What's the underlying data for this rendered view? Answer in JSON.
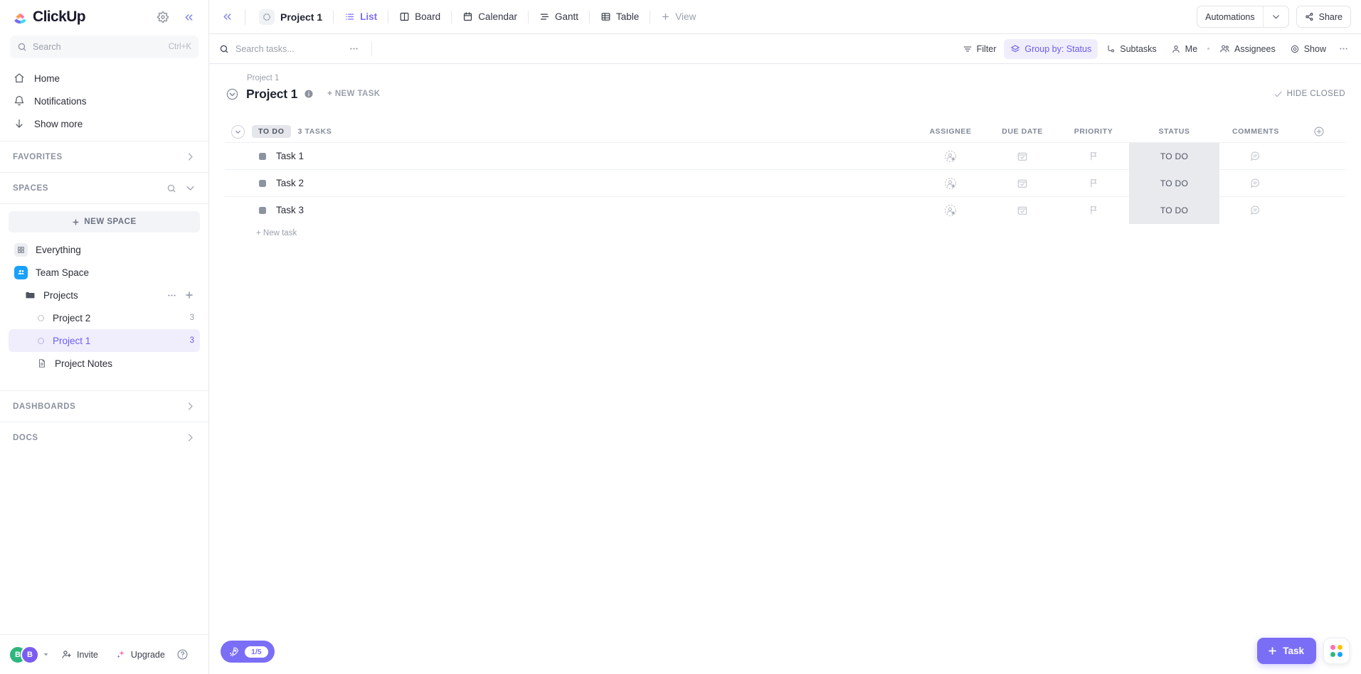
{
  "brand": {
    "name": "ClickUp",
    "accent": "#7b6ef6",
    "accent_soft": "#f0eefc",
    "blue": "#18a0fb"
  },
  "sidebar": {
    "settings_icon": "gear-icon",
    "collapse_icon": "chevrons-left-icon",
    "search": {
      "placeholder": "Search",
      "shortcut": "Ctrl+K",
      "icon": "search-icon"
    },
    "nav": [
      {
        "label": "Home",
        "icon": "home-icon"
      },
      {
        "label": "Notifications",
        "icon": "bell-icon"
      },
      {
        "label": "Show more",
        "icon": "arrow-down-icon"
      }
    ],
    "favorites": {
      "label": "FAVORITES",
      "chevron": "chevron-right-icon"
    },
    "spaces": {
      "label": "SPACES",
      "search_icon": "search-icon",
      "chevron": "chevron-down-icon"
    },
    "new_space": {
      "label": "NEW SPACE",
      "icon": "plus-icon"
    },
    "tree": [
      {
        "label": "Everything",
        "icon": "grid-icon",
        "count": "",
        "indent": 0,
        "selected": false
      },
      {
        "label": "Team Space",
        "icon": "people-icon",
        "count": "",
        "indent": 0,
        "selected": false
      },
      {
        "label": "Projects",
        "icon": "folder-icon",
        "count": "",
        "indent": 1,
        "selected": false,
        "actions": true
      },
      {
        "label": "Project 2",
        "icon": "list-circle-icon",
        "count": "3",
        "indent": 2,
        "selected": false
      },
      {
        "label": "Project 1",
        "icon": "list-circle-icon",
        "count": "3",
        "indent": 2,
        "selected": true
      },
      {
        "label": "Project Notes",
        "icon": "doc-icon",
        "count": "",
        "indent": 2,
        "selected": false
      }
    ],
    "dashboards": {
      "label": "DASHBOARDS",
      "chevron": "chevron-right-icon"
    },
    "docs": {
      "label": "DOCS",
      "chevron": "chevron-right-icon"
    },
    "footer": {
      "avatars": [
        {
          "initial": "B",
          "color": "#2eb67d"
        },
        {
          "initial": "B",
          "color": "#7b5cf0"
        }
      ],
      "avatar_caret": "caret-down-icon",
      "invite": {
        "label": "Invite",
        "icon": "person-plus-icon"
      },
      "upgrade": {
        "label": "Upgrade",
        "icon": "sparkle-icon"
      },
      "help": {
        "label": "?",
        "icon": "help-circle-icon"
      }
    }
  },
  "topbar": {
    "collapse_icon": "chevrons-left-icon",
    "view_name": "Project 1",
    "tabs": [
      {
        "label": "List",
        "icon": "list-icon",
        "active": true
      },
      {
        "label": "Board",
        "icon": "board-icon",
        "active": false
      },
      {
        "label": "Calendar",
        "icon": "calendar-icon",
        "active": false
      },
      {
        "label": "Gantt",
        "icon": "gantt-icon",
        "active": false
      },
      {
        "label": "Table",
        "icon": "table-icon",
        "active": false
      }
    ],
    "add_view": {
      "label": "View",
      "icon": "plus-icon"
    },
    "automations": {
      "label": "Automations",
      "chevron": "chevron-down-icon"
    },
    "share": {
      "label": "Share",
      "icon": "share-icon"
    }
  },
  "toolbar": {
    "search": {
      "placeholder": "Search tasks...",
      "icon": "search-icon"
    },
    "more_icon": "ellipsis-icon",
    "buttons": [
      {
        "label": "Filter",
        "icon": "filter-icon",
        "active": false
      },
      {
        "label": "Group by: Status",
        "icon": "layers-icon",
        "active": true
      },
      {
        "label": "Subtasks",
        "icon": "subtask-icon",
        "active": false
      },
      {
        "label": "Me",
        "icon": "person-icon",
        "active": false
      },
      {
        "label": "Assignees",
        "icon": "people-icon",
        "active": false
      },
      {
        "label": "Show",
        "icon": "eye-icon",
        "active": false
      }
    ],
    "overflow_icon": "ellipsis-icon"
  },
  "list_view": {
    "breadcrumb": "Project 1",
    "title": "Project 1",
    "caret_icon": "chevron-down-circle-icon",
    "info_icon": "info-icon",
    "new_task_label": "+ NEW TASK",
    "hide_closed": {
      "label": "HIDE CLOSED",
      "icon": "check-icon"
    },
    "group": {
      "status_label": "TO DO",
      "task_count_label": "3 TASKS",
      "caret_icon": "chevron-down-circle-icon"
    },
    "columns": [
      {
        "key": "assignee",
        "label": "ASSIGNEE"
      },
      {
        "key": "due_date",
        "label": "DUE DATE"
      },
      {
        "key": "priority",
        "label": "PRIORITY"
      },
      {
        "key": "status",
        "label": "STATUS"
      },
      {
        "key": "comments",
        "label": "COMMENTS"
      }
    ],
    "add_column_icon": "plus-circle-icon",
    "tasks": [
      {
        "name": "Task 1",
        "assignee": "",
        "assignee_icon": "add-assignee-icon",
        "due_date": "",
        "due_icon": "calendar-icon",
        "priority": "",
        "priority_icon": "flag-icon",
        "status": "TO DO",
        "comments": "",
        "comments_icon": "comment-icon"
      },
      {
        "name": "Task 2",
        "assignee": "",
        "assignee_icon": "add-assignee-icon",
        "due_date": "",
        "due_icon": "calendar-icon",
        "priority": "",
        "priority_icon": "flag-icon",
        "status": "TO DO",
        "comments": "",
        "comments_icon": "comment-icon"
      },
      {
        "name": "Task 3",
        "assignee": "",
        "assignee_icon": "add-assignee-icon",
        "due_date": "",
        "due_icon": "calendar-icon",
        "priority": "",
        "priority_icon": "flag-icon",
        "status": "TO DO",
        "comments": "",
        "comments_icon": "comment-icon"
      }
    ],
    "new_task_row": "+ New task"
  },
  "floating": {
    "onboarding": {
      "progress": "1/5",
      "icon": "rocket-icon"
    },
    "task_fab": {
      "label": "Task",
      "icon": "plus-icon"
    },
    "apps_fab": {
      "icon": "apps-grid-icon"
    }
  }
}
